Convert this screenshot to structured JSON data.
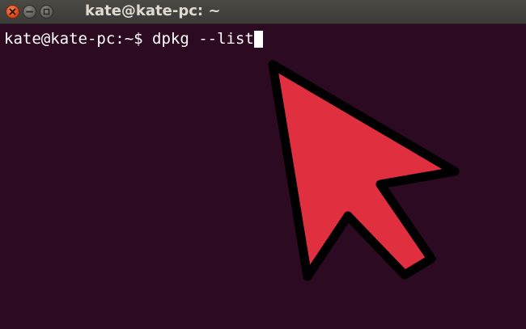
{
  "window": {
    "title": "kate@kate-pc: ~",
    "controls": [
      "close-icon",
      "minimize-icon",
      "maximize-icon"
    ]
  },
  "terminal": {
    "prompt": "kate@kate-pc:~$",
    "command": "dpkg --list",
    "background_color": "#2c0a22",
    "text_color": "#ffffff"
  },
  "overlay": {
    "icon": "mouse-pointer-arrow-icon",
    "color": "#e03040",
    "outline_color": "#000000"
  }
}
